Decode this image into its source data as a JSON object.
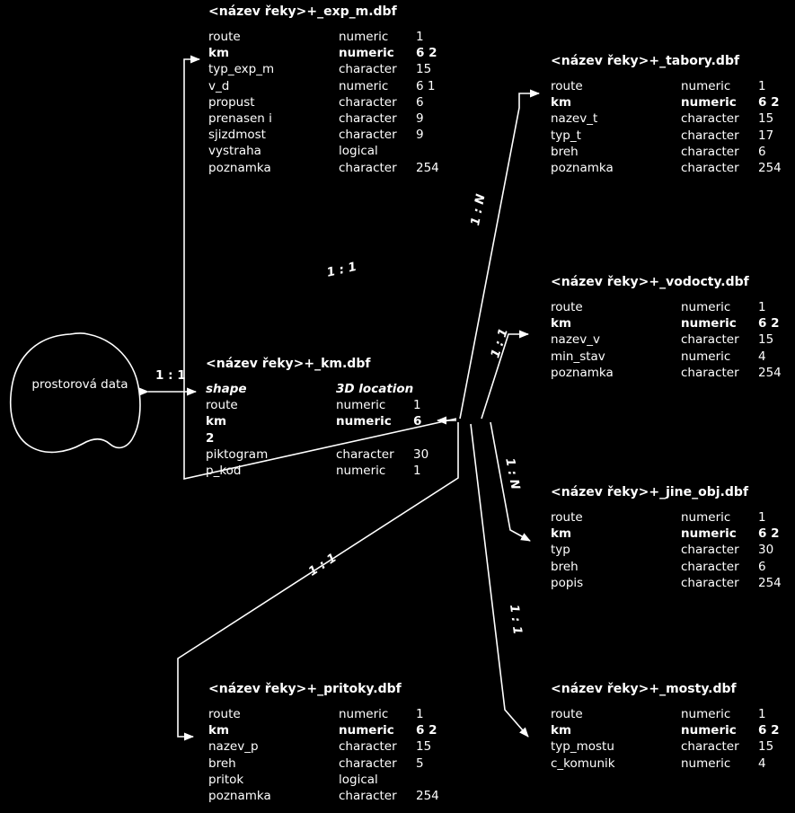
{
  "diagram": {
    "spatial_node": {
      "label": "prostorová data",
      "icon": "blob-shape"
    },
    "central_relation": {
      "label": "1 : 1"
    },
    "tables": [
      {
        "id": "exp_m",
        "title": "<název řeky>+_exp_m.dbf",
        "fields": [
          {
            "name": "route",
            "type": "numeric",
            "len": "1",
            "key": false
          },
          {
            "name": "km",
            "type": "numeric",
            "len": "6 2",
            "key": true
          },
          {
            "name": "typ_exp_m",
            "type": "character",
            "len": "15",
            "key": false
          },
          {
            "name": "v_d",
            "type": "numeric",
            "len": "6 1",
            "key": false
          },
          {
            "name": "propust",
            "type": "character",
            "len": "6",
            "key": false
          },
          {
            "name": "prenasen i",
            "type": "character",
            "len": "9",
            "key": false
          },
          {
            "name": "sjizdmost",
            "type": "character",
            "len": "9",
            "key": false
          },
          {
            "name": "vystraha",
            "type": "logical",
            "len": "",
            "key": false
          },
          {
            "name": "poznamka",
            "type": "character",
            "len": "254",
            "key": false
          }
        ]
      },
      {
        "id": "tabory",
        "title": "<název řeky>+_tabory.dbf",
        "fields": [
          {
            "name": "route",
            "type": "numeric",
            "len": "1",
            "key": false
          },
          {
            "name": "km",
            "type": "numeric",
            "len": "6 2",
            "key": true
          },
          {
            "name": "nazev_t",
            "type": "character",
            "len": "15",
            "key": false
          },
          {
            "name": "typ_t",
            "type": "character",
            "len": "17",
            "key": false
          },
          {
            "name": "breh",
            "type": "character",
            "len": "6",
            "key": false
          },
          {
            "name": "poznamka",
            "type": "character",
            "len": "254",
            "key": false
          }
        ]
      },
      {
        "id": "vodocty",
        "title": "<název řeky>+_vodocty.dbf",
        "fields": [
          {
            "name": "route",
            "type": "numeric",
            "len": "1",
            "key": false
          },
          {
            "name": "km",
            "type": "numeric",
            "len": "6 2",
            "key": true
          },
          {
            "name": "nazev_v",
            "type": "character",
            "len": "15",
            "key": false
          },
          {
            "name": "min_stav",
            "type": "numeric",
            "len": "4",
            "key": false
          },
          {
            "name": "poznamka",
            "type": "character",
            "len": "254",
            "key": false
          }
        ]
      },
      {
        "id": "km",
        "title": "<název řeky>+_km.dbf",
        "fields": [
          {
            "name": "shape",
            "type": "3D location",
            "len": "",
            "shape": true
          },
          {
            "name": "route",
            "type": "numeric",
            "len": "1",
            "key": false
          },
          {
            "name": "km",
            "type": "numeric",
            "len": "6",
            "key": true
          },
          {
            "name": "2",
            "type": "",
            "len": "",
            "cont": true
          },
          {
            "name": "piktogram",
            "type": "character",
            "len": "30",
            "key": false
          },
          {
            "name": "p_kod",
            "type": "numeric",
            "len": "1",
            "key": false
          }
        ]
      },
      {
        "id": "jine_obj",
        "title": "<název řeky>+_jine_obj.dbf",
        "fields": [
          {
            "name": "route",
            "type": "numeric",
            "len": "1",
            "key": false
          },
          {
            "name": "km",
            "type": "numeric",
            "len": "6 2",
            "key": true
          },
          {
            "name": "typ",
            "type": "character",
            "len": "30",
            "key": false
          },
          {
            "name": "breh",
            "type": "character",
            "len": "6",
            "key": false
          },
          {
            "name": "popis",
            "type": "character",
            "len": "254",
            "key": false
          }
        ]
      },
      {
        "id": "pritoky",
        "title": "<název řeky>+_pritoky.dbf",
        "fields": [
          {
            "name": "route",
            "type": "numeric",
            "len": "1",
            "key": false
          },
          {
            "name": "km",
            "type": "numeric",
            "len": "6 2",
            "key": true
          },
          {
            "name": "nazev_p",
            "type": "character",
            "len": "15",
            "key": false
          },
          {
            "name": "breh",
            "type": "character",
            "len": "5",
            "key": false
          },
          {
            "name": "pritok",
            "type": "logical",
            "len": "",
            "key": false
          },
          {
            "name": "poznamka",
            "type": "character",
            "len": "254",
            "key": false
          }
        ]
      },
      {
        "id": "mosty",
        "title": "<název řeky>+_mosty.dbf",
        "fields": [
          {
            "name": "route",
            "type": "numeric",
            "len": "1",
            "key": false
          },
          {
            "name": "km",
            "type": "numeric",
            "len": "6 2",
            "key": true
          },
          {
            "name": "typ_mostu",
            "type": "character",
            "len": "15",
            "key": false
          },
          {
            "name": "c_komunik",
            "type": "numeric",
            "len": "4",
            "key": false
          }
        ]
      }
    ],
    "relationships": [
      {
        "id": "exp_m",
        "label": "1 : 1"
      },
      {
        "id": "tabory",
        "label": "1 : N"
      },
      {
        "id": "vodocty",
        "label": "1 : 1"
      },
      {
        "id": "jine_obj",
        "label": "1 : N"
      },
      {
        "id": "mosty",
        "label": "1 : 1"
      },
      {
        "id": "pritoky",
        "label": "1 : 1"
      }
    ]
  }
}
